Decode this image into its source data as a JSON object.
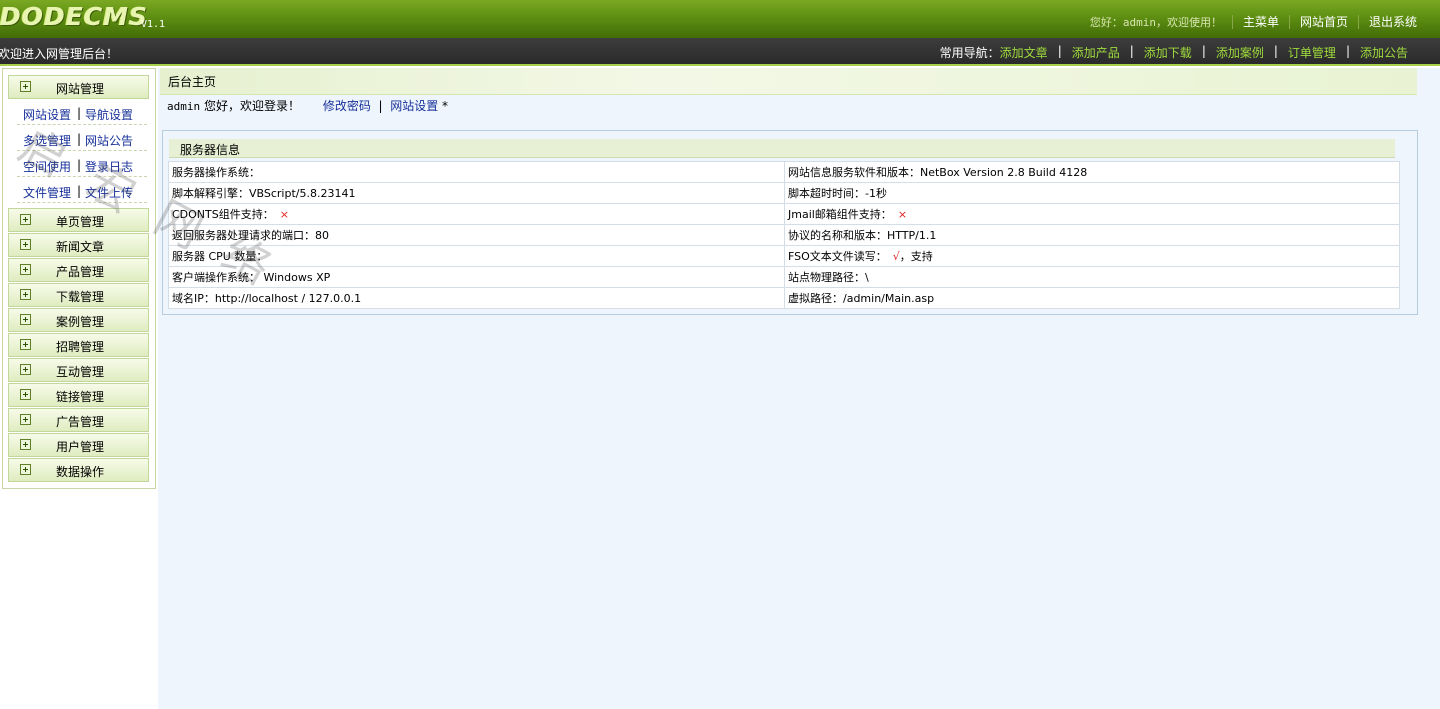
{
  "header": {
    "logo_text": "DODECMS",
    "version": "V1.1",
    "welcome": "您好：admin，欢迎使用！",
    "nav": [
      "主菜单",
      "网站首页",
      "退出系统"
    ]
  },
  "subbar": {
    "marquee": "欢迎进入网管理后台！",
    "quicknav_label": "常用导航：",
    "quicknav": [
      "添加文章",
      "添加产品",
      "添加下载",
      "添加案例",
      "订单管理",
      "添加公告"
    ]
  },
  "sidebar": {
    "first_group": "网站管理",
    "sub_items": [
      [
        "网站设置",
        "导航设置"
      ],
      [
        "多选管理",
        "网站公告"
      ],
      [
        "空间使用",
        "登录日志"
      ],
      [
        "文件管理",
        "文件上传"
      ]
    ],
    "groups": [
      "单页管理",
      "新闻文章",
      "产品管理",
      "下载管理",
      "案例管理",
      "招聘管理",
      "互动管理",
      "链接管理",
      "广告管理",
      "用户管理",
      "数据操作"
    ]
  },
  "main": {
    "breadcrumb": "后台主页",
    "welcome_user": "admin",
    "welcome_text": "您好，欢迎登录！",
    "link_password": "修改密码",
    "link_sep": "|",
    "link_settings": "网站设置",
    "link_star": "*",
    "server_title": "服务器信息",
    "rows": [
      [
        "服务器操作系统：",
        "网站信息服务软件和版本：NetBox Version 2.8 Build 4128"
      ],
      [
        "脚本解释引擎：VBScript/5.8.23141",
        "脚本超时时间：-1秒"
      ],
      [
        "CDONTS组件支持：",
        "Jmail邮箱组件支持："
      ],
      [
        "返回服务器处理请求的端口：80",
        "协议的名称和版本：HTTP/1.1"
      ],
      [
        "服务器 CPU 数量：",
        "FSO文本文件读写："
      ],
      [
        "客户端操作系统： Windows XP",
        "站点物理路径：\\"
      ],
      [
        "域名IP：http://localhost / 127.0.0.1",
        "虚拟路径：/admin/Main.asp"
      ]
    ],
    "mark_x": "×",
    "mark_tick": "√",
    "fso_support": "，支持"
  },
  "watermark": "启 宏 网 络"
}
